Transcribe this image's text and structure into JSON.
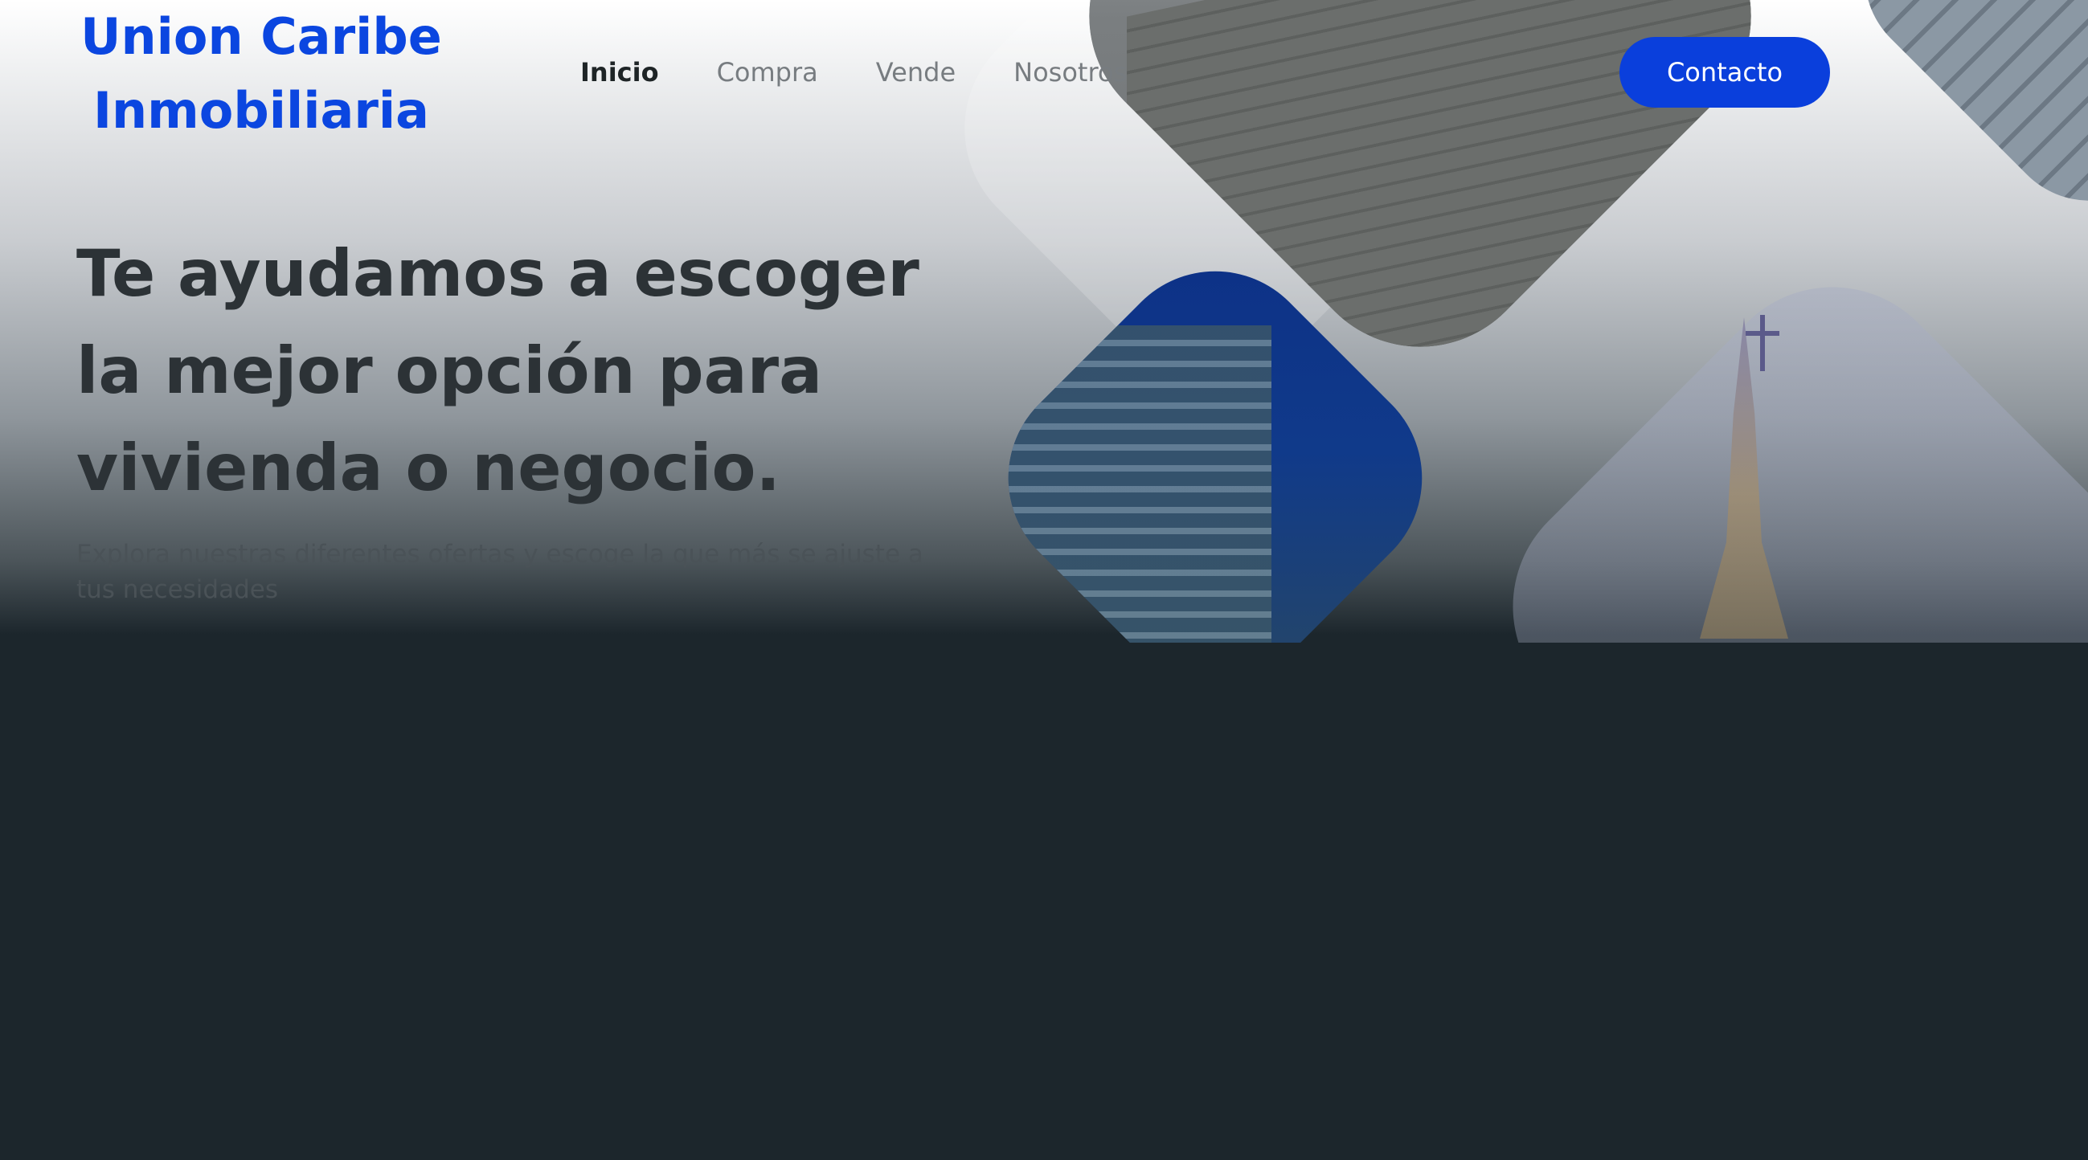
{
  "brand": {
    "line1": "Union Caribe",
    "line2": "Inmobiliaria"
  },
  "nav": {
    "items": [
      {
        "label": "Inicio",
        "active": true
      },
      {
        "label": "Compra",
        "active": false
      },
      {
        "label": "Vende",
        "active": false
      },
      {
        "label": "Nosotros",
        "active": false
      }
    ]
  },
  "cta": {
    "label": "Contacto"
  },
  "hero": {
    "headline_1": "Te ayudamos a escoger",
    "headline_2": "la mejor opción para",
    "headline_3": "vivienda o negocio.",
    "subtitle": "Explora nuestras diferentes ofertas y escoge la que más se ajuste a tus necesidades"
  },
  "colors": {
    "brand": "#0b46e0",
    "cta": "#0a3fdc",
    "page_bg": "#1c262c",
    "headline": "#2c3236"
  }
}
